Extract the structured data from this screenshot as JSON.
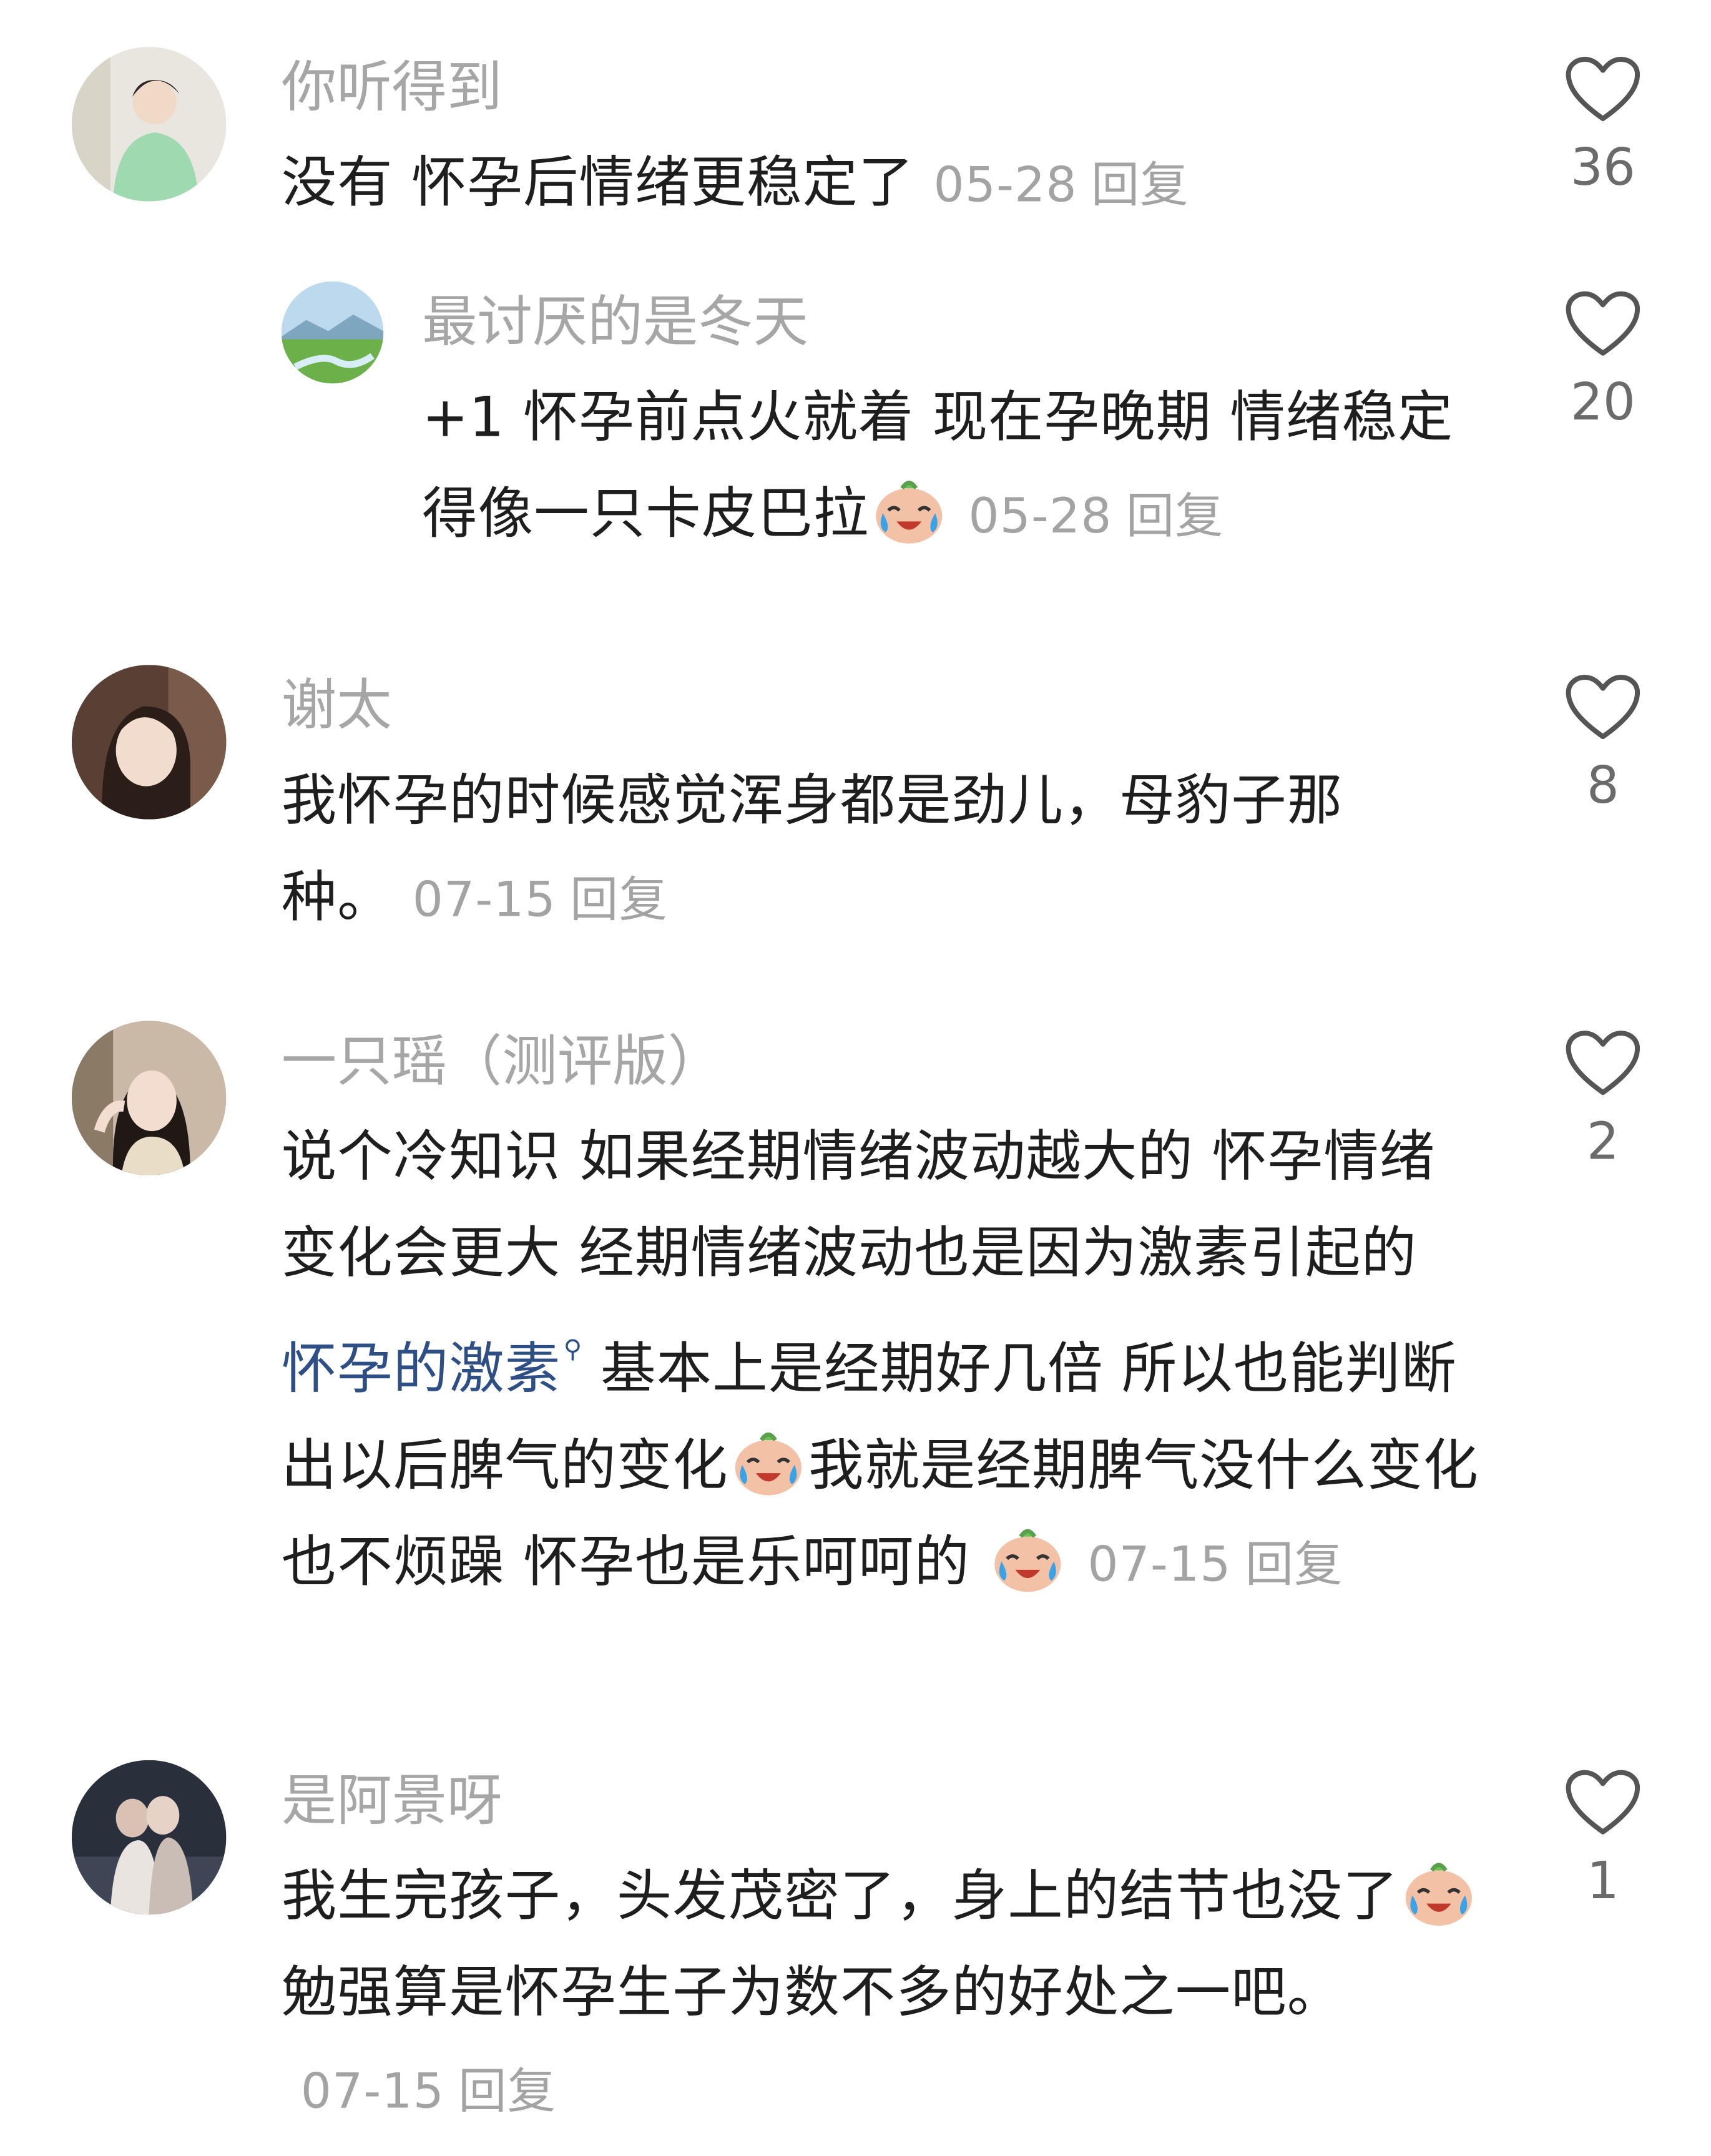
{
  "comments": [
    {
      "username": "你听得到",
      "text": "没有 怀孕后情绪更稳定了",
      "date": "05-28",
      "reply_label": "回复",
      "likes": "36",
      "avatar_icon": "avatar-person-green-shirt"
    },
    {
      "username": "最讨厌的是冬天",
      "text": "+1 怀孕前点火就着 现在孕晚期 情绪稳定得像一只卡皮巴拉",
      "date": "05-28",
      "reply_label": "回复",
      "likes": "20",
      "avatar_icon": "avatar-landscape"
    },
    {
      "username": "谢太",
      "text": "我怀孕的时候感觉浑身都是劲儿，母豹子那种。",
      "date": "07-15",
      "reply_label": "回复",
      "likes": "8",
      "avatar_icon": "avatar-woman-portrait"
    },
    {
      "username": "一只瑶（测评版）",
      "text_part1": "说个冷知识 如果经期情绪波动越大的 怀孕情绪变化会更大 经期情绪波动也是因为激素引起的 ",
      "link_text": "怀孕的激素",
      "text_part2": " 基本上是经期好几倍 所以也能判断出以后脾气的变化",
      "text_part3": "我就是经期脾气没什么变化 也不烦躁 怀孕也是乐呵呵的",
      "date": "07-15",
      "reply_label": "回复",
      "likes": "2",
      "avatar_icon": "avatar-woman-selfie"
    },
    {
      "username": "是阿景呀",
      "text_part1": "我生完孩子，头发茂密了，身上的结节也没了",
      "text_part2": " 勉强算是怀孕生子为数不多的好处之一吧。",
      "date": "07-15",
      "reply_label": "回复",
      "likes": "1",
      "avatar_icon": "avatar-couple-photo"
    }
  ],
  "colors": {
    "username": "#a6a6a6",
    "body_text": "#1e1e1e",
    "meta": "#a3a3a3",
    "link": "#2d4f86",
    "heart": "#555555"
  }
}
